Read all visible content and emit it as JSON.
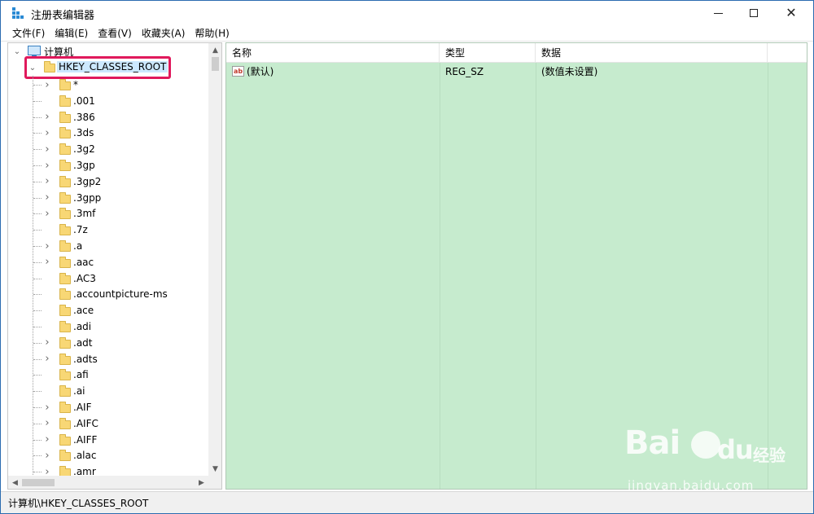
{
  "window": {
    "title": "注册表编辑器",
    "controls": {
      "minimize": "minimize",
      "maximize": "maximize",
      "close": "✕"
    }
  },
  "menu": [
    "文件(F)",
    "编辑(E)",
    "查看(V)",
    "收藏夹(A)",
    "帮助(H)"
  ],
  "tree": {
    "root_label": "计算机",
    "selected_key": "HKEY_CLASSES_ROOT",
    "children": [
      {
        "label": "*",
        "expandable": true
      },
      {
        "label": ".001",
        "expandable": false
      },
      {
        "label": ".386",
        "expandable": true
      },
      {
        "label": ".3ds",
        "expandable": true
      },
      {
        "label": ".3g2",
        "expandable": true
      },
      {
        "label": ".3gp",
        "expandable": true
      },
      {
        "label": ".3gp2",
        "expandable": true
      },
      {
        "label": ".3gpp",
        "expandable": true
      },
      {
        "label": ".3mf",
        "expandable": true
      },
      {
        "label": ".7z",
        "expandable": false
      },
      {
        "label": ".a",
        "expandable": true
      },
      {
        "label": ".aac",
        "expandable": true
      },
      {
        "label": ".AC3",
        "expandable": false
      },
      {
        "label": ".accountpicture-ms",
        "expandable": false
      },
      {
        "label": ".ace",
        "expandable": false
      },
      {
        "label": ".adi",
        "expandable": false
      },
      {
        "label": ".adt",
        "expandable": true
      },
      {
        "label": ".adts",
        "expandable": true
      },
      {
        "label": ".afi",
        "expandable": false
      },
      {
        "label": ".ai",
        "expandable": false
      },
      {
        "label": ".AIF",
        "expandable": true
      },
      {
        "label": ".AIFC",
        "expandable": true
      },
      {
        "label": ".AIFF",
        "expandable": true
      },
      {
        "label": ".alac",
        "expandable": true
      },
      {
        "label": ".amr",
        "expandable": true
      }
    ]
  },
  "list": {
    "columns": [
      "名称",
      "类型",
      "数据"
    ],
    "rows": [
      {
        "name": "(默认)",
        "type": "REG_SZ",
        "data": "(数值未设置)",
        "icon": "ab"
      }
    ]
  },
  "status": {
    "path": "计算机\\HKEY_CLASSES_ROOT"
  },
  "watermark": {
    "brand": "Bai",
    "brand2": "du",
    "cn": "经验",
    "url": "jingyan.baidu.com"
  },
  "colors": {
    "list_bg": "#c6ebce",
    "highlight_border": "#e0195c",
    "folder": "#f8d775"
  }
}
